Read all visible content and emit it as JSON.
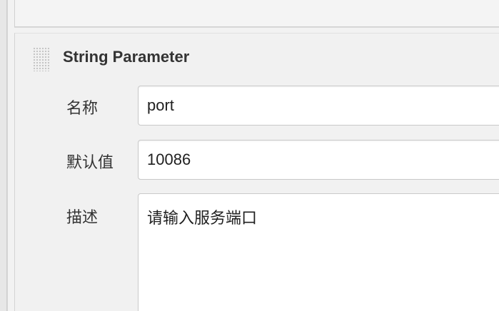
{
  "param": {
    "title": "String Parameter",
    "fields": [
      {
        "label": "名称",
        "value": "port"
      },
      {
        "label": "默认值",
        "value": "10086"
      },
      {
        "label": "描述",
        "value": "请输入服务端口"
      }
    ]
  }
}
